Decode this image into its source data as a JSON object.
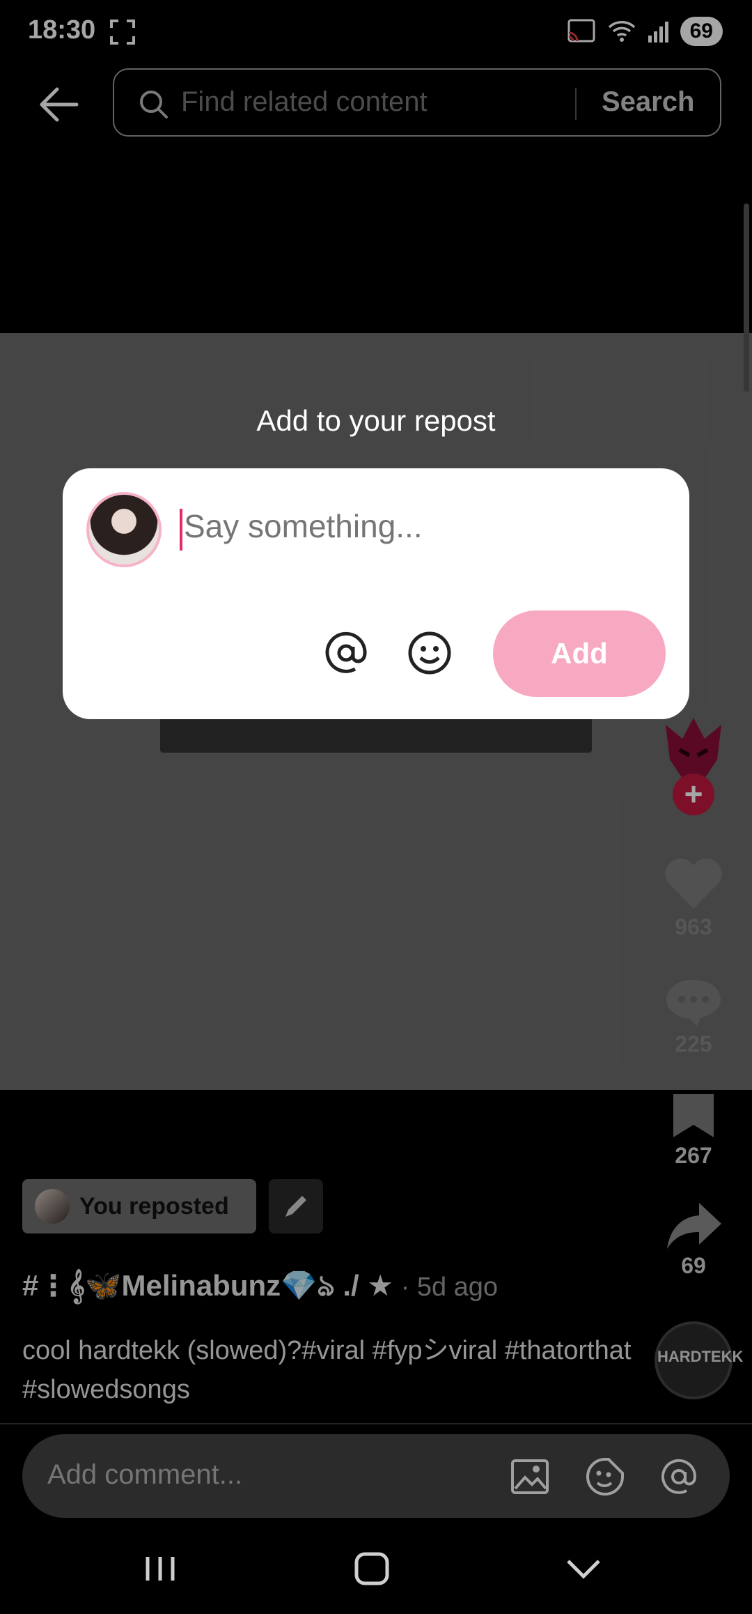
{
  "status_bar": {
    "time": "18:30",
    "battery": "69"
  },
  "search": {
    "placeholder": "Find related content",
    "button": "Search"
  },
  "modal": {
    "title": "Add to your repost",
    "placeholder": "Say something...",
    "add_label": "Add"
  },
  "rail": {
    "likes": "963",
    "comments": "225",
    "bookmarks": "267",
    "shares": "69"
  },
  "post": {
    "repost_label": "You reposted",
    "author": "#⋮𝄞🦋Melinabunz💎ঌ ./ ★",
    "time": " · 5d ago",
    "caption": "cool hardtekk (slowed)?#viral #fypシviral #thatorthat #slowedsongs",
    "sound_label": "HARDTEKK"
  },
  "comment_bar": {
    "placeholder": "Add comment..."
  },
  "colors": {
    "accent": "#e32b6a",
    "add_button": "#f7a9c1",
    "follow_badge": "#c0183f"
  }
}
